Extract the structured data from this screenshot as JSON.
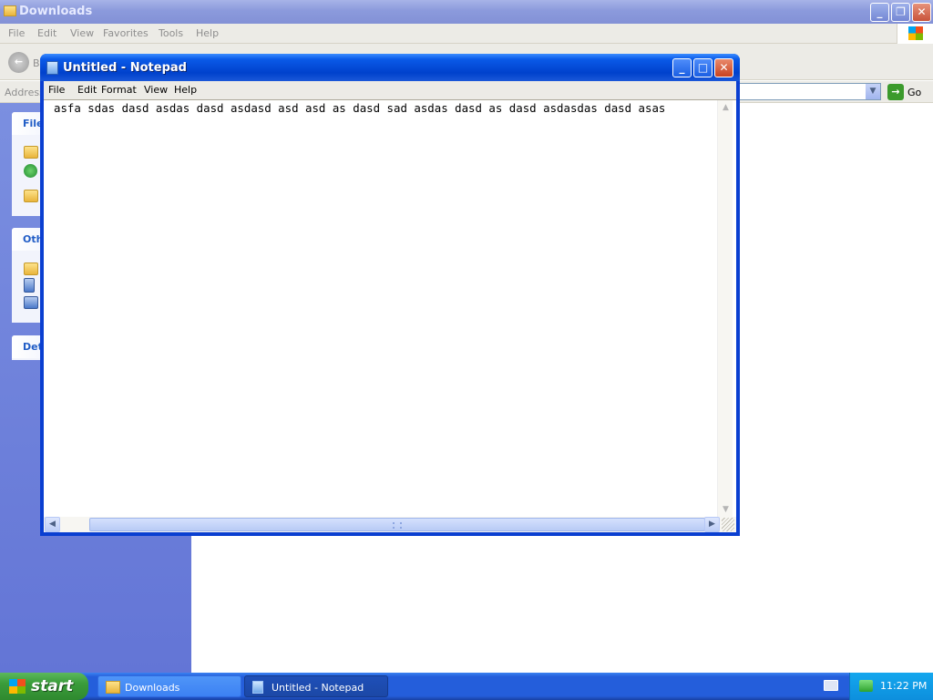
{
  "explorer": {
    "title": "Downloads",
    "menu": [
      "File",
      "Edit",
      "View",
      "Favorites",
      "Tools",
      "Help"
    ],
    "back_label": "B",
    "address_label": "Address",
    "go_label": "Go",
    "panels": [
      {
        "header": "File"
      },
      {
        "header": "Oth"
      },
      {
        "header": "Det"
      }
    ]
  },
  "notepad": {
    "title": "Untitled - Notepad",
    "menu": [
      "File",
      "Edit",
      "Format",
      "View",
      "Help"
    ],
    "content": "asfa sdas dasd asdas dasd asdasd asd asd as dasd sad asdas dasd as dasd asdasdas dasd asas"
  },
  "taskbar": {
    "start_label": "start",
    "tasks": [
      {
        "label": "Downloads",
        "icon": "folder-icon"
      },
      {
        "label": "Untitled - Notepad",
        "icon": "notepad-icon"
      }
    ],
    "clock": "11:22 PM"
  },
  "colors": {
    "xp_blue": "#0a3fd1",
    "start_green": "#3a9c3a",
    "tray_blue": "#0d8fdd"
  }
}
